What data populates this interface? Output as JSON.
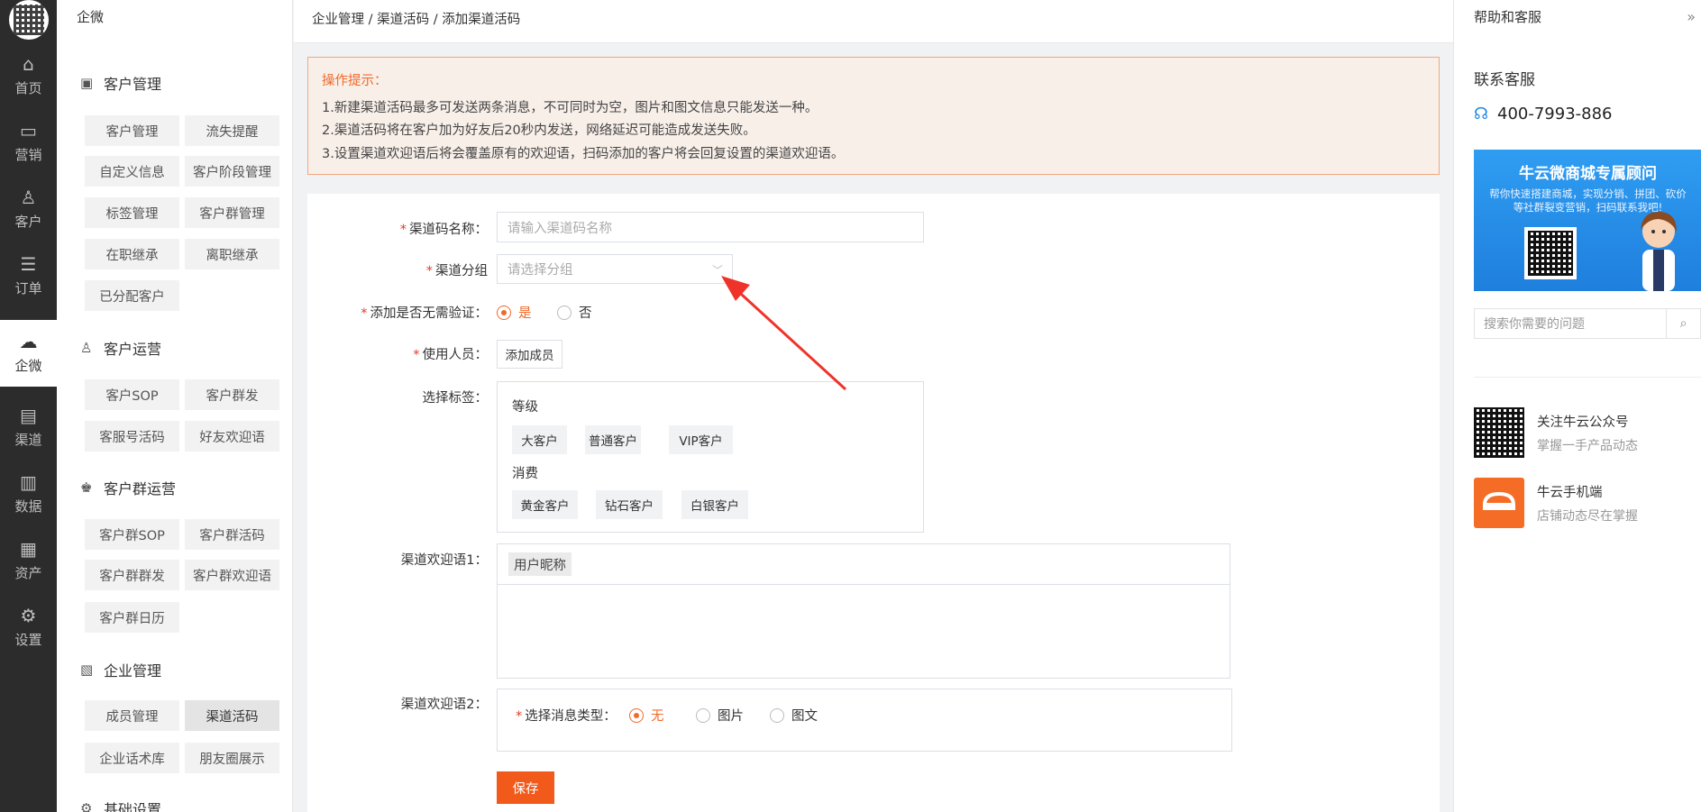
{
  "rail": {
    "items": [
      {
        "label": "首页",
        "icon": "home-icon"
      },
      {
        "label": "营销",
        "icon": "marketing-icon"
      },
      {
        "label": "客户",
        "icon": "user-icon"
      },
      {
        "label": "订单",
        "icon": "order-icon"
      },
      {
        "label": "企微",
        "icon": "wecom-icon"
      },
      {
        "label": "渠道",
        "icon": "channel-icon"
      },
      {
        "label": "数据",
        "icon": "data-icon"
      },
      {
        "label": "资产",
        "icon": "asset-icon"
      },
      {
        "label": "设置",
        "icon": "gear-icon"
      }
    ],
    "active": "企微"
  },
  "subnav": {
    "title": "企微",
    "groups": [
      {
        "title": "客户管理",
        "items": [
          "客户管理",
          "流失提醒",
          "自定义信息",
          "客户阶段管理",
          "标签管理",
          "客户群管理",
          "在职继承",
          "离职继承",
          "已分配客户"
        ]
      },
      {
        "title": "客户运营",
        "items": [
          "客户SOP",
          "客户群发",
          "客服号活码",
          "好友欢迎语"
        ]
      },
      {
        "title": "客户群运营",
        "items": [
          "客户群SOP",
          "客户群活码",
          "客户群群发",
          "客户群欢迎语",
          "客户群日历"
        ]
      },
      {
        "title": "企业管理",
        "items": [
          "成员管理",
          "渠道活码",
          "企业话术库",
          "朋友圈展示"
        ]
      },
      {
        "title": "基础设置",
        "items": []
      }
    ],
    "active_item": "渠道活码"
  },
  "breadcrumb": "企业管理 / 渠道活码 / 添加渠道活码",
  "tip": {
    "title": "操作提示：",
    "lines": [
      "1.新建渠道活码最多可发送两条消息，不可同时为空，图片和图文信息只能发送一种。",
      "2.渠道活码将在客户加为好友后20秒内发送，网络延迟可能造成发送失败。",
      "3.设置渠道欢迎语后将会覆盖原有的欢迎语，扫码添加的客户将会回复设置的渠道欢迎语。"
    ]
  },
  "form": {
    "name_label": "渠道码名称：",
    "name_placeholder": "请输入渠道码名称",
    "group_label": "渠道分组",
    "group_placeholder": "请选择分组",
    "verify_label": "添加是否无需验证：",
    "verify_yes": "是",
    "verify_no": "否",
    "verify_value": "是",
    "users_label": "使用人员：",
    "add_member": "添加成员",
    "tags_label": "选择标签：",
    "tag_groups": [
      {
        "name": "等级",
        "tags": [
          "大客户",
          "普通客户",
          "VIP客户"
        ]
      },
      {
        "name": "消费",
        "tags": [
          "黄金客户",
          "钻石客户",
          "白银客户"
        ]
      }
    ],
    "welcome1_label": "渠道欢迎语1：",
    "nickname_chip": "用户昵称",
    "welcome2_label": "渠道欢迎语2：",
    "msgtype_label": "选择消息类型：",
    "msgtype_options": [
      "无",
      "图片",
      "图文"
    ],
    "msgtype_value": "无",
    "save": "保存"
  },
  "right": {
    "title": "帮助和客服",
    "contact_title": "联系客服",
    "phone": "400-7993-886",
    "banner_title": "牛云微商城专属顾问",
    "banner_sub": "帮你快速搭建商城，实现分销、拼团、砍价等社群裂变营销，扫码联系我吧!",
    "search_placeholder": "搜索你需要的问题",
    "follow": [
      {
        "title": "关注牛云公众号",
        "sub": "掌握一手产品动态"
      },
      {
        "title": "牛云手机端",
        "sub": "店铺动态尽在掌握"
      }
    ]
  },
  "colors": {
    "accent": "#f25a1b",
    "rail": "#2c2c2c",
    "tip_bg": "#f8efe9"
  }
}
